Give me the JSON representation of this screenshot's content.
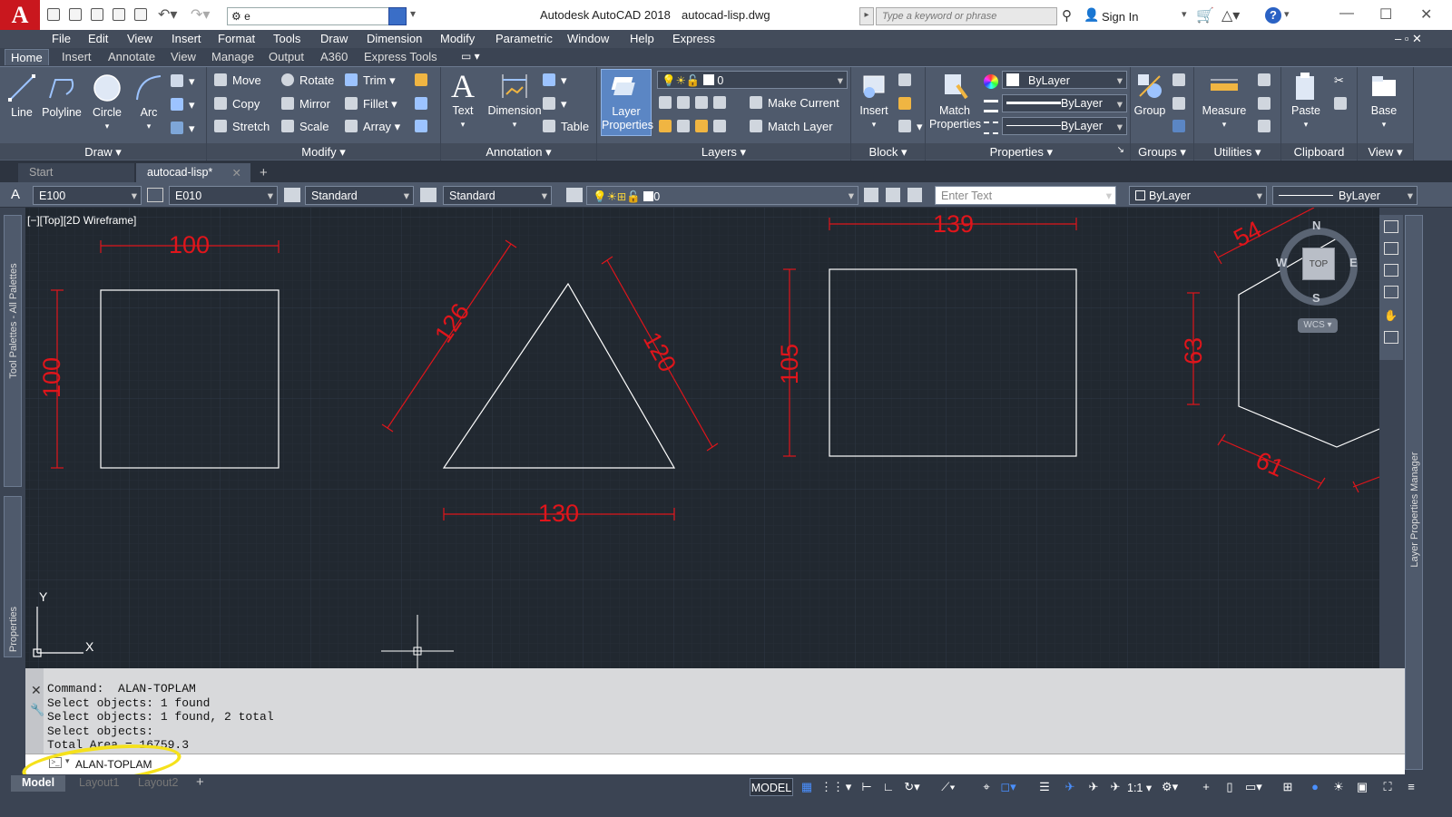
{
  "app": {
    "title": "Autodesk AutoCAD 2018",
    "file": "autocad-lisp.dwg",
    "workspace_value": "e",
    "search_placeholder": "Type a keyword or phrase",
    "sign_in": "Sign In"
  },
  "menu": [
    "File",
    "Edit",
    "View",
    "Insert",
    "Format",
    "Tools",
    "Draw",
    "Dimension",
    "Modify",
    "Parametric",
    "Window",
    "Help",
    "Express"
  ],
  "ribbon_tabs": [
    "Home",
    "Insert",
    "Annotate",
    "View",
    "Manage",
    "Output",
    "A360",
    "Express Tools"
  ],
  "draw_panel": {
    "title": "Draw",
    "line": "Line",
    "polyline": "Polyline",
    "circle": "Circle",
    "arc": "Arc"
  },
  "modify_panel": {
    "title": "Modify",
    "move": "Move",
    "rotate": "Rotate",
    "trim": "Trim",
    "copy": "Copy",
    "mirror": "Mirror",
    "fillet": "Fillet",
    "stretch": "Stretch",
    "scale": "Scale",
    "array": "Array"
  },
  "annotation_panel": {
    "title": "Annotation",
    "text": "Text",
    "dimension": "Dimension",
    "table": "Table"
  },
  "layers_panel": {
    "title": "Layers",
    "layer_properties_1": "Layer",
    "layer_properties_2": "Properties",
    "layer_value": "0",
    "make_current": "Make Current",
    "match_layer": "Match Layer"
  },
  "block_panel": {
    "title": "Block",
    "insert": "Insert"
  },
  "properties_panel": {
    "title": "Properties",
    "match_1": "Match",
    "match_2": "Properties",
    "color": "ByLayer",
    "lineweight": "ByLayer",
    "linetype": "ByLayer"
  },
  "groups_panel": {
    "title": "Groups",
    "group": "Group"
  },
  "utilities_panel": {
    "title": "Utilities",
    "measure": "Measure"
  },
  "clipboard_panel": {
    "title": "Clipboard",
    "paste": "Paste"
  },
  "view_panel": {
    "title": "View",
    "base": "Base"
  },
  "doc_tabs": [
    "Start",
    "autocad-lisp*"
  ],
  "prop_toolbar": {
    "text_style": "E100",
    "dim_style": "E010",
    "table_style": "Standard",
    "mleader_style": "Standard",
    "layer": "0",
    "enter_text_placeholder": "Enter Text",
    "color": "ByLayer",
    "linetype": "ByLayer"
  },
  "viewport_label": "[−][Top][2D Wireframe]",
  "viewcube": {
    "top": "TOP",
    "n": "N",
    "s": "S",
    "e": "E",
    "w": "W",
    "wcs": "WCS"
  },
  "ucs": {
    "x": "X",
    "y": "Y"
  },
  "dimensions": {
    "square_w": "100",
    "square_h": "100",
    "tri_left": "126",
    "tri_right": "120",
    "tri_base": "130",
    "rect_w": "139",
    "rect_h": "105",
    "hex_top": "54",
    "hex_side": "63",
    "hex_bottom": "61"
  },
  "side_palettes": {
    "left_top": "Tool Palettes - All Palettes",
    "left_bottom": "Properties",
    "right": "Layer Properties Manager"
  },
  "command_history": [
    "Command:  ALAN-TOPLAM",
    "Select objects: 1 found",
    "Select objects: 1 found, 2 total",
    "Select objects:",
    "Total Area = 16759.3"
  ],
  "command_input": "ALAN-TOPLAM",
  "layout_tabs": [
    "Model",
    "Layout1",
    "Layout2"
  ],
  "status": {
    "model": "MODEL",
    "scale": "1:1"
  },
  "colors": {
    "dimension": "#e0151b",
    "geometry": "#ffffff",
    "canvas": "#212830",
    "highlight": "#f5e11b"
  }
}
